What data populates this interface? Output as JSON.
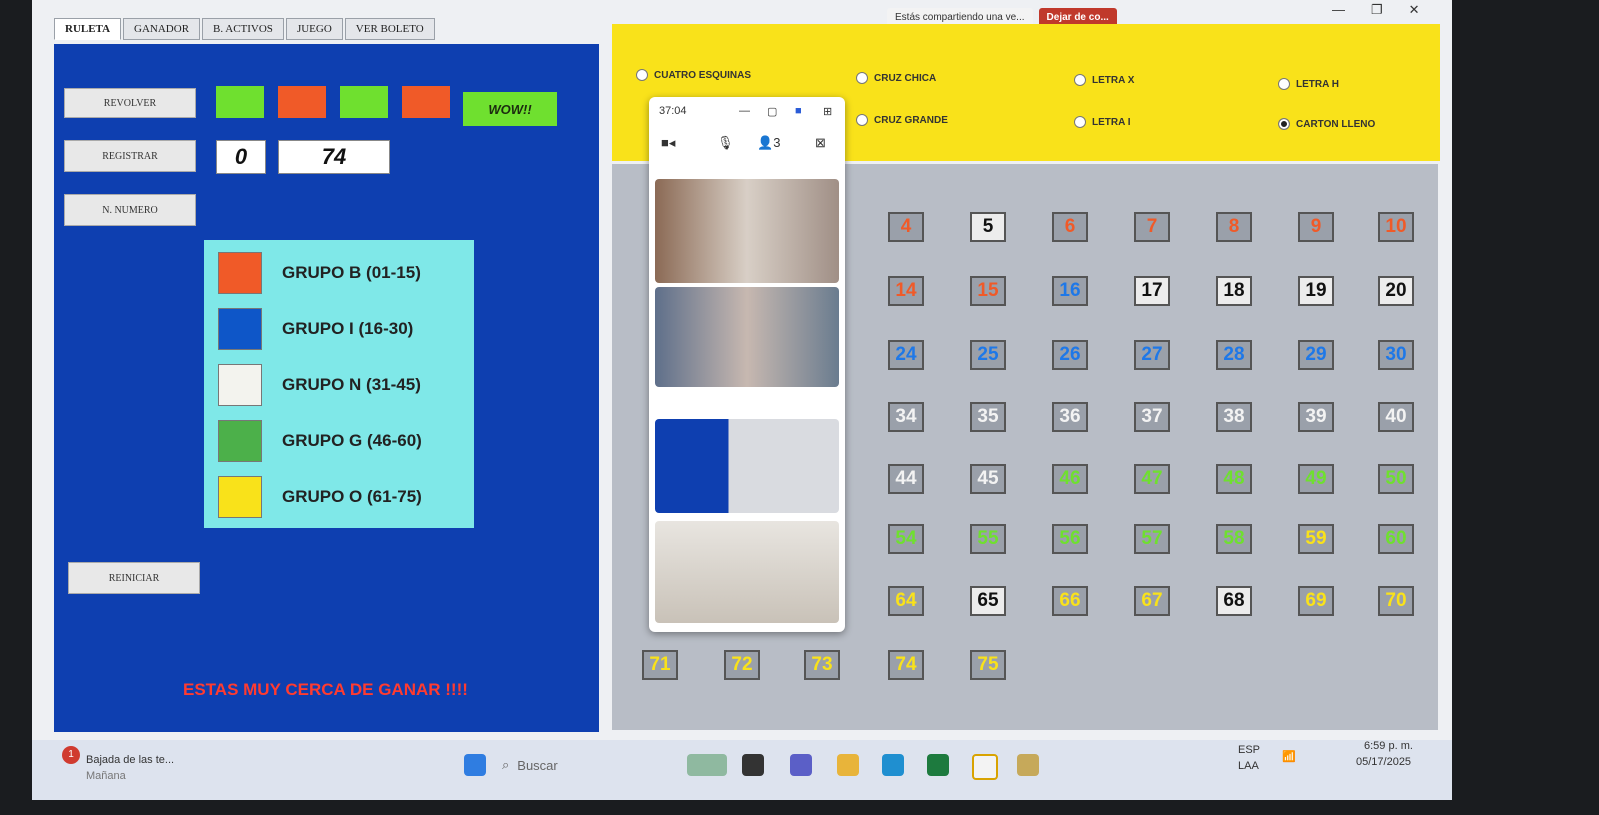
{
  "tabs": [
    "RULETA",
    "GANADOR",
    "B. ACTIVOS",
    "JUEGO",
    "VER BOLETO"
  ],
  "share": {
    "text": "Estás compartiendo una ve...",
    "stop": "Dejar de co..."
  },
  "window_controls": {
    "minimize": "—",
    "restore": "❐",
    "close": "✕"
  },
  "left": {
    "revolver": "REVOLVER",
    "registrar": "REGISTRAR",
    "n_numero": "N. NUMERO",
    "reiniciar": "REINICIAR",
    "wow": "WOW!!",
    "count": "0",
    "last_number": "74",
    "swatch_colors": [
      "#6fe02f",
      "#f05a28",
      "#6fe02f",
      "#f05a28"
    ],
    "near_win": "ESTAS MUY CERCA DE GANAR !!!!"
  },
  "legend": [
    {
      "label": "GRUPO B (01-15)",
      "color": "#f05a28"
    },
    {
      "label": "GRUPO I (16-30)",
      "color": "#0e56c8"
    },
    {
      "label": "GRUPO N (31-45)",
      "color": "#f3f3ee"
    },
    {
      "label": "GRUPO G (46-60)",
      "color": "#4cb04a"
    },
    {
      "label": "GRUPO O (61-75)",
      "color": "#f9e21a"
    }
  ],
  "patterns": [
    {
      "label": "CUATRO ESQUINAS",
      "selected": false
    },
    {
      "label": "CRUZ CHICA",
      "selected": false
    },
    {
      "label": "LETRA X",
      "selected": false
    },
    {
      "label": "LETRA H",
      "selected": false
    },
    {
      "label": "CRUZ GRANDE",
      "selected": false
    },
    {
      "label": "LETRA I",
      "selected": false
    },
    {
      "label": "CARTON LLENO",
      "selected": true
    }
  ],
  "board": {
    "visible": [
      {
        "n": "4",
        "g": "B"
      },
      {
        "n": "5",
        "g": "x"
      },
      {
        "n": "6",
        "g": "B"
      },
      {
        "n": "7",
        "g": "B"
      },
      {
        "n": "8",
        "g": "B"
      },
      {
        "n": "9",
        "g": "B"
      },
      {
        "n": "10",
        "g": "B"
      },
      {
        "n": "14",
        "g": "B"
      },
      {
        "n": "15",
        "g": "B"
      },
      {
        "n": "16",
        "g": "I"
      },
      {
        "n": "17",
        "g": "x"
      },
      {
        "n": "18",
        "g": "x"
      },
      {
        "n": "19",
        "g": "x"
      },
      {
        "n": "20",
        "g": "x"
      },
      {
        "n": "24",
        "g": "I"
      },
      {
        "n": "25",
        "g": "I"
      },
      {
        "n": "26",
        "g": "I"
      },
      {
        "n": "27",
        "g": "I"
      },
      {
        "n": "28",
        "g": "I"
      },
      {
        "n": "29",
        "g": "I"
      },
      {
        "n": "30",
        "g": "I"
      },
      {
        "n": "34",
        "g": "N"
      },
      {
        "n": "35",
        "g": "N"
      },
      {
        "n": "36",
        "g": "N"
      },
      {
        "n": "37",
        "g": "N"
      },
      {
        "n": "38",
        "g": "N"
      },
      {
        "n": "39",
        "g": "N"
      },
      {
        "n": "40",
        "g": "N"
      },
      {
        "n": "44",
        "g": "N"
      },
      {
        "n": "45",
        "g": "N"
      },
      {
        "n": "46",
        "g": "G"
      },
      {
        "n": "47",
        "g": "G"
      },
      {
        "n": "48",
        "g": "G"
      },
      {
        "n": "49",
        "g": "G"
      },
      {
        "n": "50",
        "g": "G"
      },
      {
        "n": "54",
        "g": "G"
      },
      {
        "n": "55",
        "g": "G"
      },
      {
        "n": "56",
        "g": "G"
      },
      {
        "n": "57",
        "g": "G"
      },
      {
        "n": "58",
        "g": "G"
      },
      {
        "n": "59",
        "g": "O"
      },
      {
        "n": "60",
        "g": "G"
      },
      {
        "n": "64",
        "g": "O"
      },
      {
        "n": "65",
        "g": "x"
      },
      {
        "n": "66",
        "g": "O"
      },
      {
        "n": "67",
        "g": "O"
      },
      {
        "n": "68",
        "g": "x"
      },
      {
        "n": "69",
        "g": "O"
      },
      {
        "n": "70",
        "g": "O"
      }
    ],
    "last_row": [
      {
        "n": "71",
        "g": "O"
      },
      {
        "n": "72",
        "g": "O"
      },
      {
        "n": "73",
        "g": "O"
      },
      {
        "n": "74",
        "g": "O"
      },
      {
        "n": "75",
        "g": "O"
      }
    ],
    "group_colors": {
      "B": "#f05a28",
      "I": "#1e78e8",
      "N": "#f3f3f3",
      "G": "#6fe02f",
      "O": "#f9e21a",
      "x": "#111111"
    }
  },
  "meeting": {
    "timer": "37:04",
    "participants": "3"
  },
  "taskbar": {
    "news_title": "Bajada de las te...",
    "news_sub": "Mañana",
    "badge": "1",
    "search": "Buscar",
    "lang": "ESP",
    "layout": "LAA",
    "time": "6:59 p. m.",
    "date": "05/17/2025"
  }
}
